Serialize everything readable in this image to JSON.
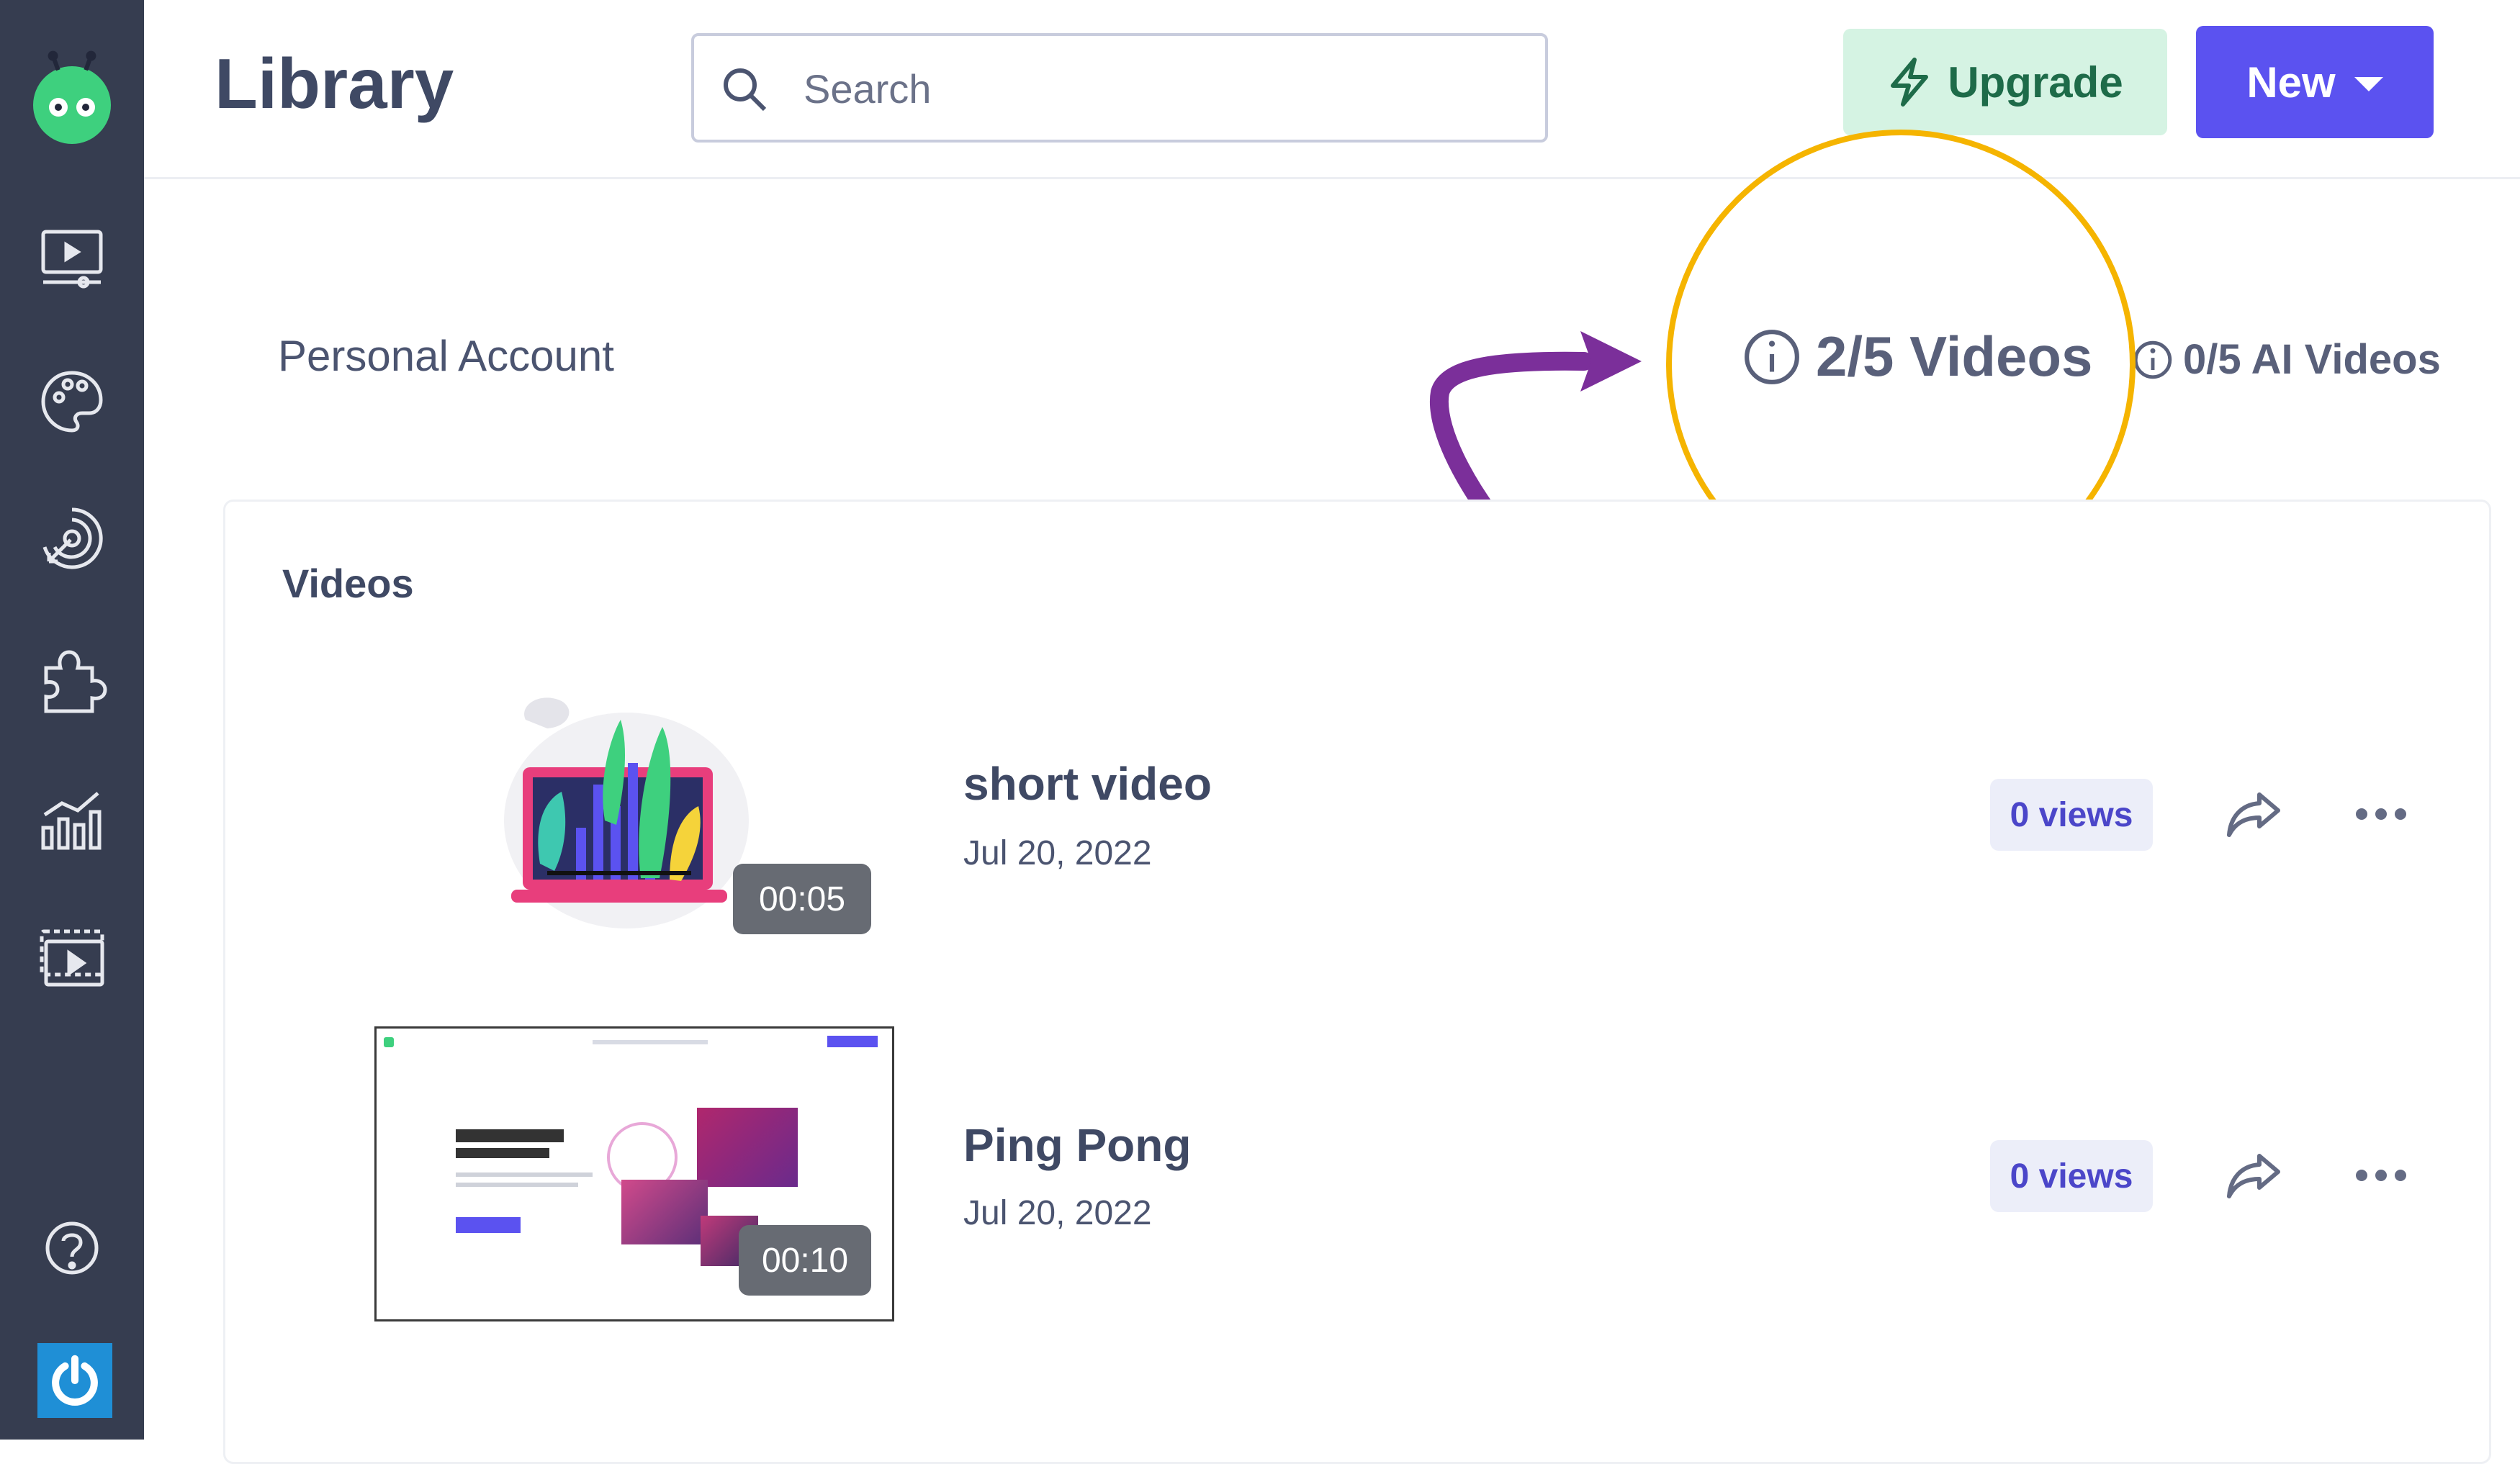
{
  "header": {
    "title": "Library",
    "search_placeholder": "Search",
    "upgrade_label": "Upgrade",
    "new_label": "New"
  },
  "account": {
    "name": "Personal Account",
    "videos_quota": "2/5 Videos",
    "ai_videos_quota": "0/5 AI Videos"
  },
  "section": {
    "title": "Videos"
  },
  "videos": [
    {
      "title": "short video",
      "date": "Jul 20, 2022",
      "duration": "00:05",
      "views": "0 views"
    },
    {
      "title": "Ping Pong",
      "date": "Jul 20, 2022",
      "duration": "00:10",
      "views": "0 views"
    }
  ],
  "sidebar": {
    "items": [
      {
        "icon": "video-player-icon"
      },
      {
        "icon": "palette-icon"
      },
      {
        "icon": "target-icon"
      },
      {
        "icon": "puzzle-icon"
      },
      {
        "icon": "analytics-icon"
      },
      {
        "icon": "media-library-icon"
      }
    ],
    "help_icon": "help-icon",
    "power_icon": "power-icon"
  },
  "colors": {
    "sidebar": "#363d50",
    "brand_green": "#3ed07e",
    "primary": "#5b52f0",
    "upgrade_bg": "#d5f3e3",
    "upgrade_text": "#1e6b49",
    "highlight_circle": "#f5b400",
    "annotation_arrow": "#7b2f9a"
  }
}
